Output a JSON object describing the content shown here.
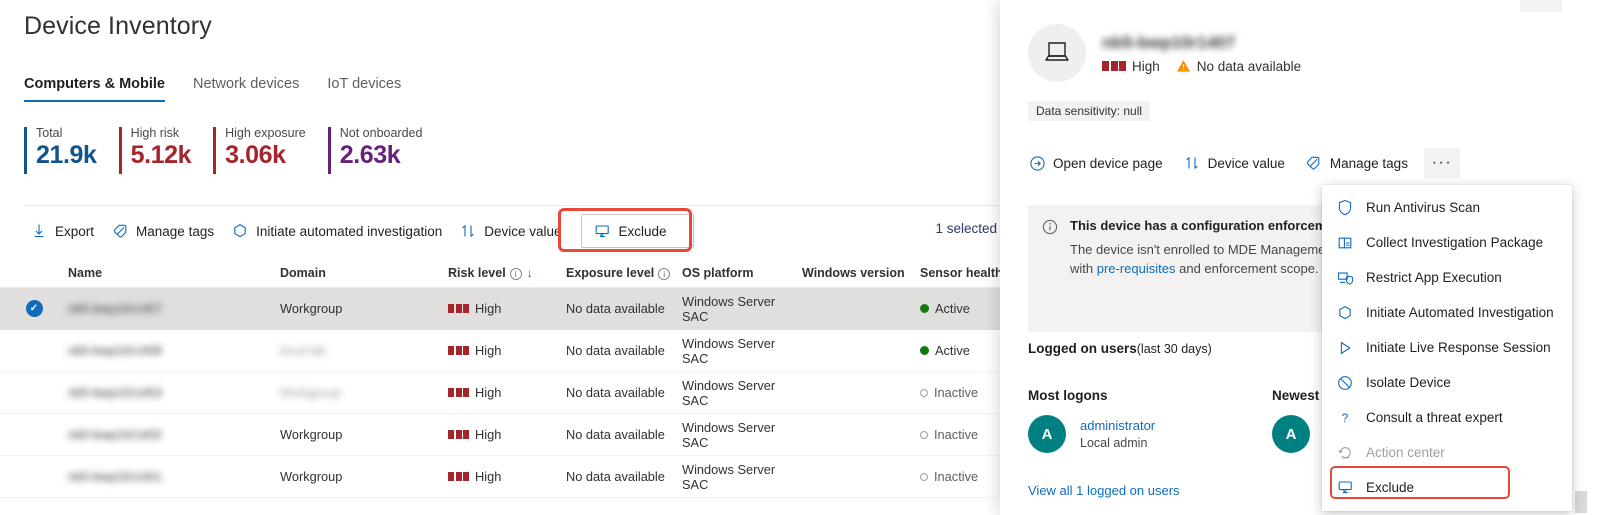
{
  "page": {
    "title": "Device Inventory"
  },
  "tabs": [
    {
      "label": "Computers & Mobile",
      "active": true
    },
    {
      "label": "Network devices",
      "active": false
    },
    {
      "label": "IoT devices",
      "active": false
    }
  ],
  "kpis": [
    {
      "label": "Total",
      "value": "21.9k",
      "color": "#0f548c"
    },
    {
      "label": "High risk",
      "value": "5.12k",
      "color": "#a4262c"
    },
    {
      "label": "High exposure",
      "value": "3.06k",
      "color": "#a4262c"
    },
    {
      "label": "Not onboarded",
      "value": "2.63k",
      "color": "#68217a"
    }
  ],
  "toolbar": {
    "items": [
      {
        "label": "Export",
        "icon": "download-icon"
      },
      {
        "label": "Manage tags",
        "icon": "tag-icon"
      },
      {
        "label": "Initiate automated investigation",
        "icon": "hexagon-icon"
      },
      {
        "label": "Device value",
        "icon": "sort-updown-icon"
      }
    ],
    "exclude_label": "Exclude",
    "exclude_icon": "monitor-exclude-icon",
    "selected_count": "1 selected",
    "highlight_color": "#e8483a"
  },
  "table": {
    "columns": [
      {
        "key": "name",
        "label": "Name"
      },
      {
        "key": "domain",
        "label": "Domain"
      },
      {
        "key": "risk",
        "label": "Risk level",
        "info": true,
        "sorted": "desc"
      },
      {
        "key": "exposure",
        "label": "Exposure level",
        "info": true
      },
      {
        "key": "os",
        "label": "OS platform"
      },
      {
        "key": "winver",
        "label": "Windows version"
      },
      {
        "key": "sensor",
        "label": "Sensor health s"
      }
    ],
    "rows": [
      {
        "name": "nb5-bwp10r1407",
        "name_redacted": true,
        "selected": true,
        "domain": "Workgroup",
        "domain_redacted": false,
        "risk": "High",
        "exposure": "No data available",
        "os": "Windows Server SAC",
        "winver": "",
        "sensor": "Active"
      },
      {
        "name": "nb5-bwp10r1408",
        "name_redacted": true,
        "selected": false,
        "domain": "local lab",
        "domain_redacted": true,
        "risk": "High",
        "exposure": "No data available",
        "os": "Windows Server SAC",
        "winver": "",
        "sensor": "Active"
      },
      {
        "name": "nb5-bwp10r1403",
        "name_redacted": true,
        "selected": false,
        "domain": "Workgroup",
        "domain_redacted": true,
        "risk": "High",
        "exposure": "No data available",
        "os": "Windows Server SAC",
        "winver": "",
        "sensor": "Inactive"
      },
      {
        "name": "nb5-bwp10r1402",
        "name_redacted": true,
        "selected": false,
        "domain": "Workgroup",
        "domain_redacted": false,
        "risk": "High",
        "exposure": "No data available",
        "os": "Windows Server SAC",
        "winver": "",
        "sensor": "Inactive"
      },
      {
        "name": "nb5-bwp10r1401",
        "name_redacted": true,
        "selected": false,
        "domain": "Workgroup",
        "domain_redacted": false,
        "risk": "High",
        "exposure": "No data available",
        "os": "Windows Server SAC",
        "winver": "",
        "sensor": "Inactive"
      }
    ]
  },
  "panel": {
    "device_name": "nb5-bwp10r1407",
    "device_icon": "laptop-icon",
    "risk_label": "High",
    "exposure_label": "No data available",
    "exposure_icon": "warning-triangle-icon",
    "sensitivity_chip": "Data sensitivity: null",
    "actions": [
      {
        "label": "Open device page",
        "icon": "arrow-right-circle-icon"
      },
      {
        "label": "Device value",
        "icon": "sort-updown-icon"
      },
      {
        "label": "Manage tags",
        "icon": "tag-icon"
      }
    ],
    "more_label": "···",
    "banner": {
      "icon": "info-circle-icon",
      "title": "This device has a configuration enforcemen",
      "line1": "The device isn't enrolled to MDE Managemen",
      "line2_pre": "with ",
      "line2_link": "pre-requisites",
      "line2_post": " and enforcement scope."
    },
    "logged_on": {
      "title_bold": "Logged on users",
      "title_rest": "(last 30 days)",
      "most_logons_header": "Most logons",
      "newest_logon_header": "Newest l",
      "most_user": {
        "initial": "A",
        "name": "administrator",
        "role": "Local admin"
      },
      "newest_user": {
        "initial": "A"
      },
      "view_all": "View all 1 logged on users"
    }
  },
  "menu": {
    "items": [
      {
        "label": "Run Antivirus Scan",
        "icon": "shield-icon",
        "disabled": false,
        "highlighted": false
      },
      {
        "label": "Collect Investigation Package",
        "icon": "package-icon",
        "disabled": false,
        "highlighted": false
      },
      {
        "label": "Restrict App Execution",
        "icon": "app-restrict-icon",
        "disabled": false,
        "highlighted": false
      },
      {
        "label": "Initiate Automated Investigation",
        "icon": "hexagon-icon",
        "disabled": false,
        "highlighted": false
      },
      {
        "label": "Initiate Live Response Session",
        "icon": "play-icon",
        "disabled": false,
        "highlighted": false
      },
      {
        "label": "Isolate Device",
        "icon": "block-icon",
        "disabled": false,
        "highlighted": false
      },
      {
        "label": "Consult a threat expert",
        "icon": "question-icon",
        "disabled": false,
        "highlighted": false
      },
      {
        "label": "Action center",
        "icon": "history-icon",
        "disabled": true,
        "highlighted": false
      },
      {
        "label": "Exclude",
        "icon": "monitor-exclude-icon",
        "disabled": false,
        "highlighted": true
      }
    ]
  }
}
